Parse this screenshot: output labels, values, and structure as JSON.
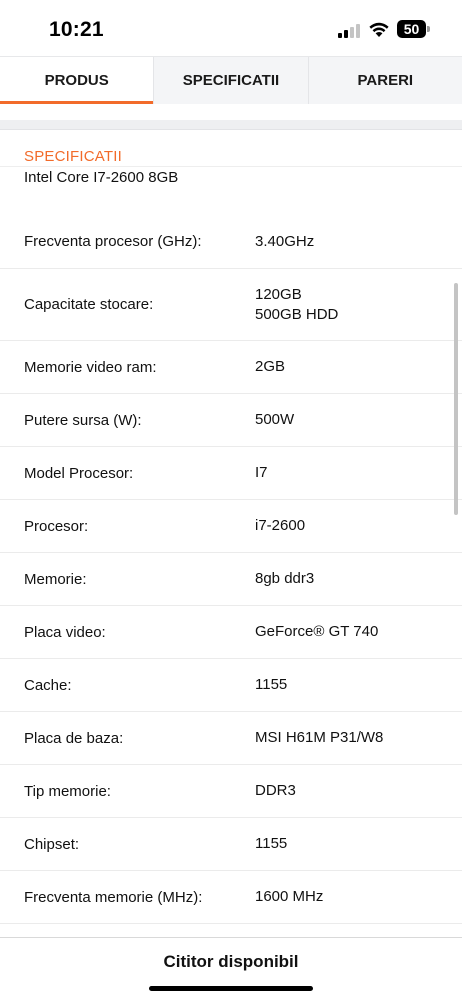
{
  "status_bar": {
    "time": "10:21",
    "battery": "50",
    "icons": [
      "signal-icon",
      "wifi-icon",
      "battery-icon"
    ]
  },
  "tabs": [
    {
      "label": "PRODUS",
      "active": true
    },
    {
      "label": "SPECIFICATII",
      "active": false
    },
    {
      "label": "PARERI",
      "active": false
    }
  ],
  "specs": {
    "heading": "SPECIFICATII",
    "product_title": "Intel Core I7-2600 8GB",
    "rows": [
      {
        "label": "Frecventa procesor (GHz):",
        "value": "3.40GHz"
      },
      {
        "label": "Capacitate stocare:",
        "value": "120GB\n500GB HDD"
      },
      {
        "label": "Memorie video ram:",
        "value": "2GB"
      },
      {
        "label": "Putere sursa (W):",
        "value": "500W"
      },
      {
        "label": "Model Procesor:",
        "value": "I7"
      },
      {
        "label": "Procesor:",
        "value": "i7-2600"
      },
      {
        "label": "Memorie:",
        "value": "8gb ddr3"
      },
      {
        "label": "Placa video:",
        "value": "GeForce® GT 740"
      },
      {
        "label": "Cache:",
        "value": "1155"
      },
      {
        "label": "Placa de baza:",
        "value": "MSI H61M P31/W8"
      },
      {
        "label": "Tip memorie:",
        "value": "DDR3"
      },
      {
        "label": "Chipset:",
        "value": "1155"
      },
      {
        "label": "Frecventa memorie (MHz):",
        "value": "1600 MHz"
      }
    ]
  },
  "reader": {
    "label": "Cititor disponibil"
  },
  "colors": {
    "accent": "#f26b2a",
    "tab_background": "#f4f5f7",
    "divider": "#ebebeb"
  }
}
